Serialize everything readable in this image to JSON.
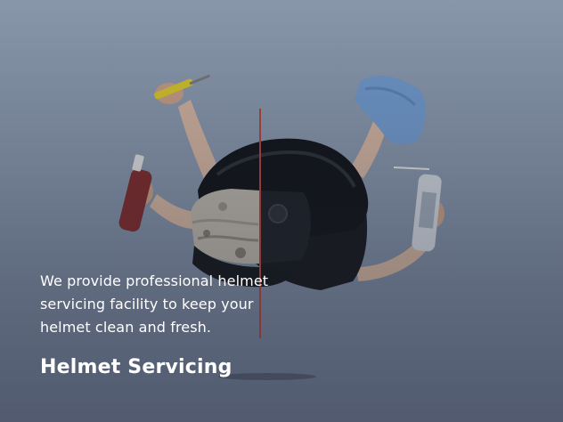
{
  "card": {
    "description": "We provide professional helmet servicing facility to keep your helmet clean and fresh.",
    "title": "Helmet Servicing"
  },
  "image": {
    "subject": "helmet-servicing-illustration"
  }
}
